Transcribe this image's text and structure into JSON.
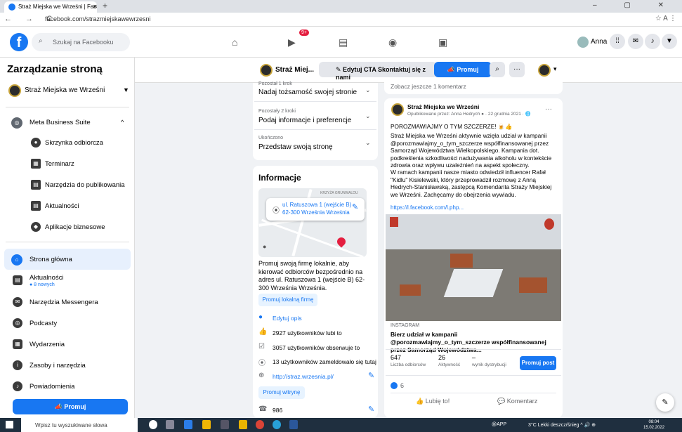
{
  "browser": {
    "tab_title": "Straż Miejska we Wrześni | Faceb",
    "tab_close": "✕",
    "new_tab": "+",
    "window_controls": "– ▢ ✕",
    "nav_buttons": "← → C",
    "url": "facebook.com/strazmiejskawewrzesni",
    "address_right": "☆ A ⋮"
  },
  "fbnav": {
    "logo": "f",
    "search_placeholder": "Szukaj na Facebooku",
    "search_icon": "⌕",
    "notif_badge": "9+",
    "user_name": "Anna",
    "icons": [
      "home-icon",
      "watch-icon",
      "marketplace-icon",
      "groups-icon",
      "gaming-icon"
    ]
  },
  "sidebar": {
    "title": "Zarządzanie stroną",
    "page_name": "Straż Miejska we Wrześni",
    "caret": "▼",
    "business_suite": "Meta Business Suite",
    "business_caret": "^",
    "suite_items": [
      "Skrzynka odbiorcza",
      "Terminarz",
      "Narzędzia do publikowania",
      "Aktualności",
      "Aplikacje biznesowe"
    ],
    "main_items": [
      {
        "label": "Strona główna",
        "sub": ""
      },
      {
        "label": "Aktualności",
        "sub": "● 8 nowych"
      },
      {
        "label": "Narzędzia Messengera",
        "sub": ""
      },
      {
        "label": "Podcasty",
        "sub": ""
      },
      {
        "label": "Wydarzenia",
        "sub": ""
      },
      {
        "label": "Zasoby i narzędzia",
        "sub": ""
      },
      {
        "label": "Powiadomienia",
        "sub": ""
      }
    ],
    "promote_label": "📣 Promuj"
  },
  "subbar": {
    "page_name": "Straż Miej...",
    "cta_label": "✎ Edytuj CTA Skontaktuj się z nami",
    "promote_label": "📣 Promuj",
    "search": "⌕",
    "more": "···",
    "caret": "▾"
  },
  "steps": [
    {
      "small": "Pozostał 1 krok",
      "big": "Nadaj tożsamość swojej stronie"
    },
    {
      "small": "Pozostały 2 kroki",
      "big": "Podaj informacje i preferencje"
    },
    {
      "small": "Ukończono",
      "big": "Przedstaw swoją stronę"
    }
  ],
  "info": {
    "title": "Informacje",
    "map_street": "KRZYŻA\nGRUNWALDU",
    "address_line1": "ul. Ratuszowa 1 (wejście B)",
    "address_line2": "62-300 Września Września",
    "promo_text": "Promuj swoją firmę lokalnie, aby kierować odbiorców bezpośrednio na adres ul. Ratuszowa 1 (wejście B) 62-300 Września Września.",
    "promote_local": "Promuj lokalną firmę",
    "edit_desc": "Edytuj opis",
    "likes": "2927 użytkowników lubi to",
    "followers": "3057 użytkowników obserwuje to",
    "checkins": "13 użytkowników zameldowało się tutaj",
    "website": "http://straz.wrzesnia.pl/",
    "promote_site": "Promuj witrynę",
    "phone": "986"
  },
  "post": {
    "see_more": "Zobacz jeszcze 1 komentarz",
    "author": "Straż Miejska we Wrześni",
    "meta": "Opublikowane przez: Anna Hedrych ● · 22 grudnia 2021 · 🌐",
    "dots": "···",
    "headline": "POROZMAWIAJMY O TYM SZCZERZE! 🍺👍",
    "body": "Straż Miejska we Wrześni aktywnie wzięła udział w kampanii @porozmawiajmy_o_tym_szczerze współfinansowanej przez Samorząd Województwa Wielkopolskiego. Kampania dot. podkreślenia szkodliwości nadużywania alkoholu w kontekście zdrowia oraz wpływu uzależnień na aspekt społeczny.",
    "body2": "W ramach kampanii nasze miasto odwiedził influencer Rafał \"Kidlu\" Kisielewski, który przeprowadził rozmowę z Anną Hedrych-Stanisławską, zastępcą Komendanta Straży Miejskiej we Wrześni. Zachęcamy do obejrzenia wywiadu.",
    "link": "https://l.facebook.com/l.php...",
    "source_label": "INSTAGRAM",
    "insta_title": "Bierz udział w kampanii @porozmawiajmy_o_tym_szczerze współfinansowanej przez Samorząd Województwa...",
    "stats": [
      {
        "n": "647",
        "l": "Liczba odbiorców"
      },
      {
        "n": "26",
        "l": "Aktywność"
      },
      {
        "n": "–",
        "l": "wynik dystrybucji"
      }
    ],
    "promote_post": "Promuj post",
    "reactions": "6",
    "like_btn": "👍 Lubię to!",
    "comment_btn": "💬 Komentarz"
  },
  "taskbar": {
    "search_placeholder": "Wpisz tu wyszukiwane słowa",
    "app_label": "@APP",
    "weather": "3°C Lekki deszcz/śnieg ^ 🔊 ⊕",
    "time": "08:04",
    "date": "15.02.2022"
  },
  "colors": {
    "brand": "#1877f2",
    "badge": "#e41e3f"
  }
}
